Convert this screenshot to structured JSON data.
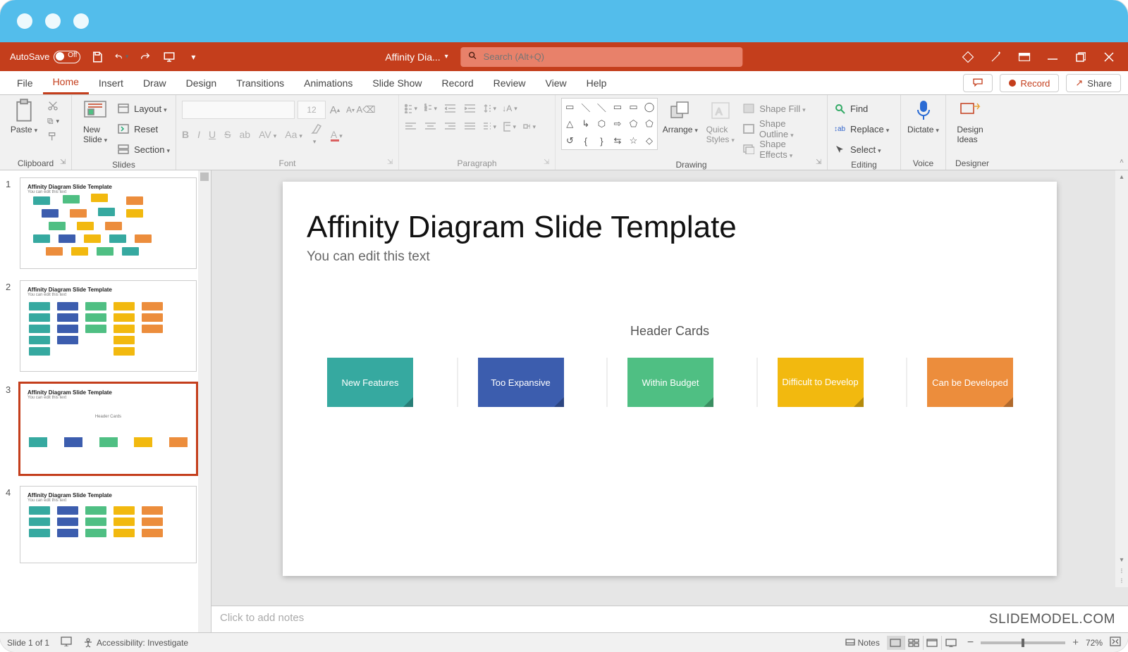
{
  "titlebar": {
    "autosave_label": "AutoSave",
    "doc_name": "Affinity Dia...",
    "search_placeholder": "Search (Alt+Q)"
  },
  "tabs": {
    "file": "File",
    "home": "Home",
    "insert": "Insert",
    "draw": "Draw",
    "design": "Design",
    "transitions": "Transitions",
    "animations": "Animations",
    "slideshow": "Slide Show",
    "record": "Record",
    "review": "Review",
    "view": "View",
    "help": "Help"
  },
  "actions": {
    "record": "Record",
    "share": "Share"
  },
  "ribbon": {
    "clipboard": {
      "label": "Clipboard",
      "paste": "Paste"
    },
    "slides": {
      "label": "Slides",
      "new_slide": "New\nSlide",
      "layout": "Layout",
      "reset": "Reset",
      "section": "Section"
    },
    "font": {
      "label": "Font",
      "size": "12"
    },
    "paragraph": {
      "label": "Paragraph"
    },
    "drawing": {
      "label": "Drawing",
      "arrange": "Arrange",
      "quick_styles": "Quick\nStyles",
      "shape_fill": "Shape Fill",
      "shape_outline": "Shape Outline",
      "shape_effects": "Shape Effects"
    },
    "editing": {
      "label": "Editing",
      "find": "Find",
      "replace": "Replace",
      "select": "Select"
    },
    "voice": {
      "label": "Voice",
      "dictate": "Dictate"
    },
    "designer": {
      "label": "Designer",
      "ideas": "Design\nIdeas"
    }
  },
  "thumbs": {
    "n1": "1",
    "n2": "2",
    "n3": "3",
    "n4": "4",
    "title": "Affinity Diagram Slide Template",
    "sub": "You can edit this text",
    "t3_label": "Header Cards"
  },
  "slide": {
    "title": "Affinity Diagram Slide Template",
    "subtitle": "You can edit this text",
    "header_label": "Header Cards",
    "cards": {
      "c1": "New Features",
      "c2": "Too Expansive",
      "c3": "Within Budget",
      "c4": "Difficult to Develop",
      "c5": "Can be Developed"
    }
  },
  "notes": {
    "placeholder": "Click to add notes"
  },
  "watermark": "SLIDEMODEL.COM",
  "status": {
    "slide_info": "Slide 1 of 1",
    "accessibility": "Accessibility: Investigate",
    "notes_btn": "Notes",
    "zoom": "72%"
  }
}
